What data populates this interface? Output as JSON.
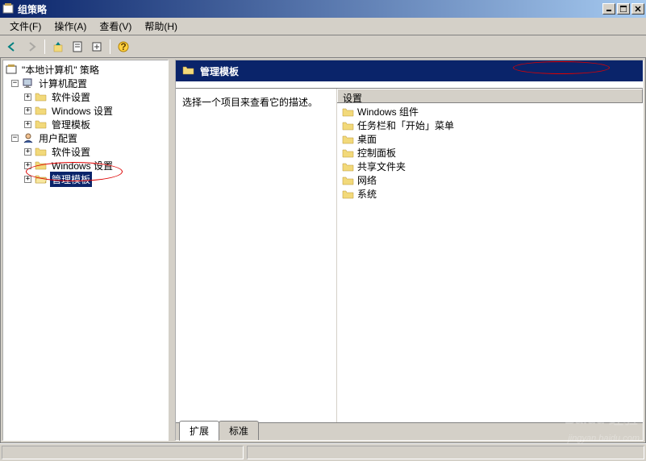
{
  "window": {
    "title": "组策略"
  },
  "menu": {
    "file": "文件(F)",
    "action": "操作(A)",
    "view": "查看(V)",
    "help": "帮助(H)"
  },
  "tree": {
    "root": "\"本地计算机\" 策略",
    "computer_config": "计算机配置",
    "user_config": "用户配置",
    "software_settings": "软件设置",
    "windows_settings": "Windows 设置",
    "admin_templates": "管理模板"
  },
  "right": {
    "header": "管理模板",
    "description": "选择一个项目来查看它的描述。",
    "column_setting": "设置",
    "items": [
      "Windows 组件",
      "任务栏和「开始」菜单",
      "桌面",
      "控制面板",
      "共享文件夹",
      "网络",
      "系统"
    ],
    "tab_extended": "扩展",
    "tab_standard": "标准"
  },
  "watermark": {
    "logo": "Baidu 经验",
    "url": "jingyan.baidu.com"
  }
}
